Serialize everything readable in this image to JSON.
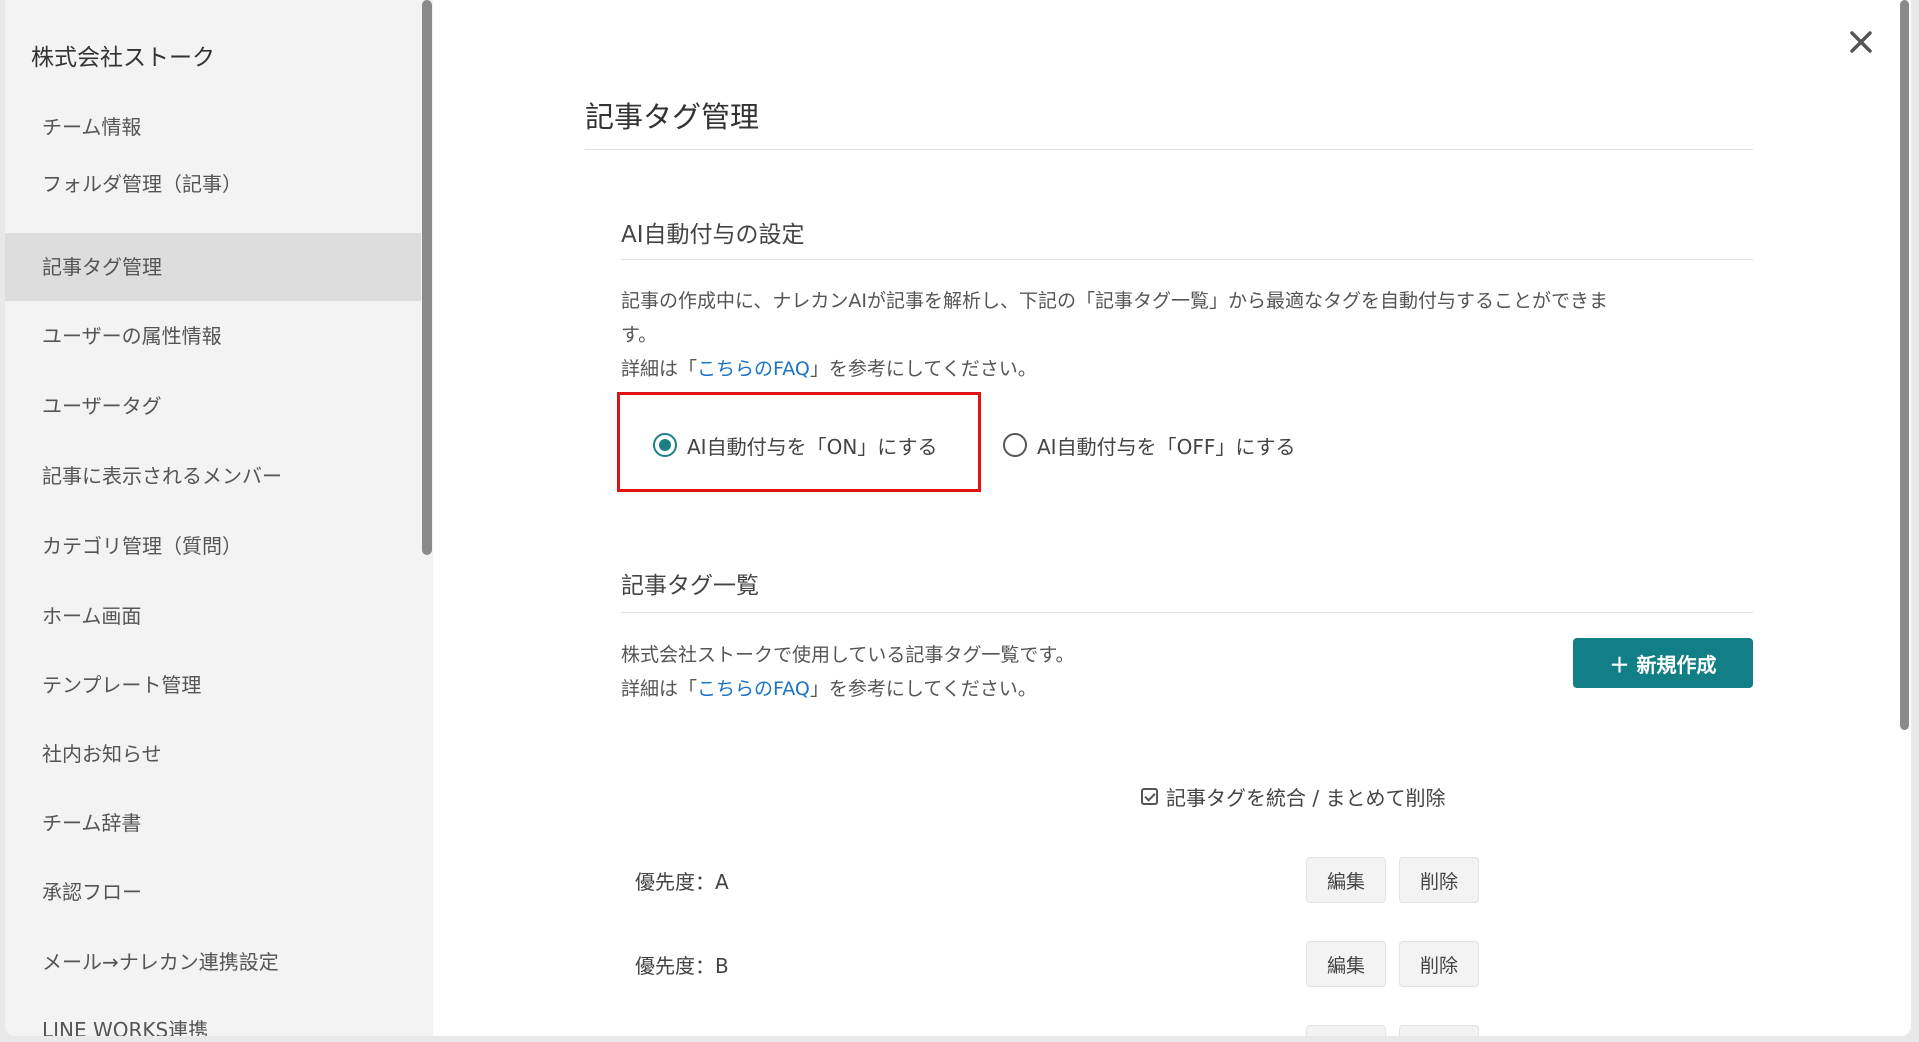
{
  "sidebar": {
    "team_name": "株式会社ストーク",
    "items": [
      {
        "label": "チーム情報"
      },
      {
        "label": "フォルダ管理（記事）"
      },
      {
        "label": "記事タグ管理"
      },
      {
        "label": "ユーザーの属性情報"
      },
      {
        "label": "ユーザータグ"
      },
      {
        "label": "記事に表示されるメンバー"
      },
      {
        "label": "カテゴリ管理（質問）"
      },
      {
        "label": "ホーム画面"
      },
      {
        "label": "テンプレート管理"
      },
      {
        "label": "社内お知らせ"
      },
      {
        "label": "チーム辞書"
      },
      {
        "label": "承認フロー"
      },
      {
        "label": "メール→ナレカン連携設定"
      },
      {
        "label": "LINE WORKS連携"
      }
    ]
  },
  "main": {
    "title": "記事タグ管理",
    "ai_section": {
      "title": "AI自動付与の設定",
      "description_line1": "記事の作成中に、ナレカンAIが記事を解析し、下記の「記事タグ一覧」から最適なタグを自動付与することができま",
      "description_line2": "す。",
      "faq_prefix": "詳細は「",
      "faq_link": "こちらのFAQ",
      "faq_suffix": "」を参考にしてください。",
      "options": [
        {
          "label": "AI自動付与を「ON」にする",
          "selected": true
        },
        {
          "label": "AI自動付与を「OFF」にする",
          "selected": false
        }
      ]
    },
    "tag_section": {
      "title": "記事タグ一覧",
      "description": "株式会社ストークで使用している記事タグ一覧です。",
      "faq_prefix": "詳細は「",
      "faq_link": "こちらのFAQ",
      "faq_suffix": "」を参考にしてください。",
      "new_button": "＋ 新規作成",
      "merge_label": "記事タグを統合 / まとめて削除",
      "edit_label": "編集",
      "delete_label": "削除",
      "tags": [
        {
          "name": "優先度：A"
        },
        {
          "name": "優先度：B"
        }
      ]
    }
  },
  "colors": {
    "accent": "#127f86",
    "link": "#1a75c6",
    "highlight": "#e01414"
  },
  "icons": {
    "close": "close-icon",
    "checkbox": "checkbox-icon"
  }
}
